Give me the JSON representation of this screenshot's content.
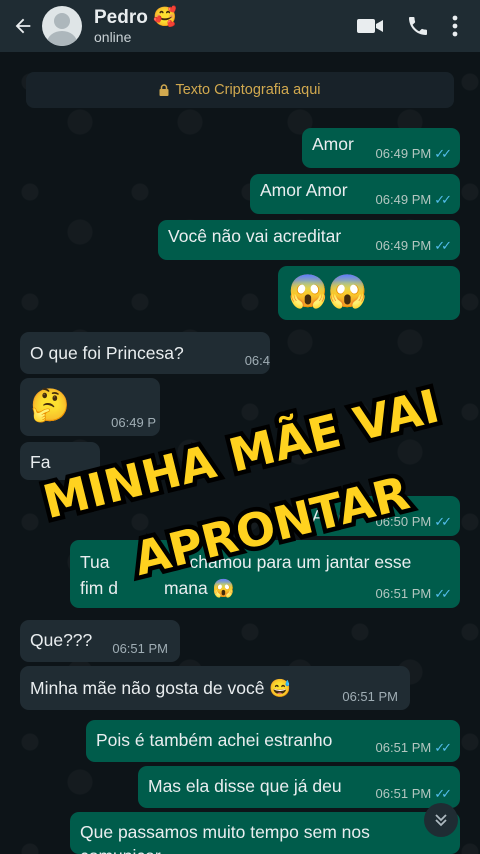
{
  "header": {
    "name": "Pedro 🥰",
    "status": "online"
  },
  "encryption": "Texto Criptografia aqui",
  "messages": [
    {
      "text": "Amor",
      "time": "06:49 PM"
    },
    {
      "text": "Amor Amor",
      "time": "06:49 PM"
    },
    {
      "text": "Você não vai acreditar",
      "time": "06:49 PM"
    },
    {
      "text": "😱😱",
      "time": ""
    },
    {
      "text": "O que foi Princesa?",
      "time": "06:4"
    },
    {
      "text": "🤔",
      "time": "06:49 P"
    },
    {
      "text": "Fa",
      "time": ""
    },
    {
      "text": "Amor",
      "time": "06:50 PM"
    },
    {
      "text": "Tua",
      "text2": "chamou para um jantar  esse",
      "text3": "fim d",
      "text4": "mana 😱",
      "time": "06:51 PM"
    },
    {
      "text": "Que???",
      "time": "06:51 PM"
    },
    {
      "text": "Minha mãe não gosta de você 😅",
      "time": "06:51 PM"
    },
    {
      "text": "Pois é também achei estranho",
      "time": "06:51 PM"
    },
    {
      "text": "Mas ela disse que já deu",
      "time": "06:51 PM"
    },
    {
      "text": "Que passamos muito tempo sem nos",
      "text2": "comunicar",
      "time": ""
    }
  ],
  "overlay": {
    "line1": "MINHA MÃE VAI",
    "line2": "APRONTAR"
  },
  "colors": {
    "header": "#1f2c33",
    "outgoing": "#005c4b",
    "incoming": "#202c33",
    "overlay_fill": "#ffd21f"
  }
}
